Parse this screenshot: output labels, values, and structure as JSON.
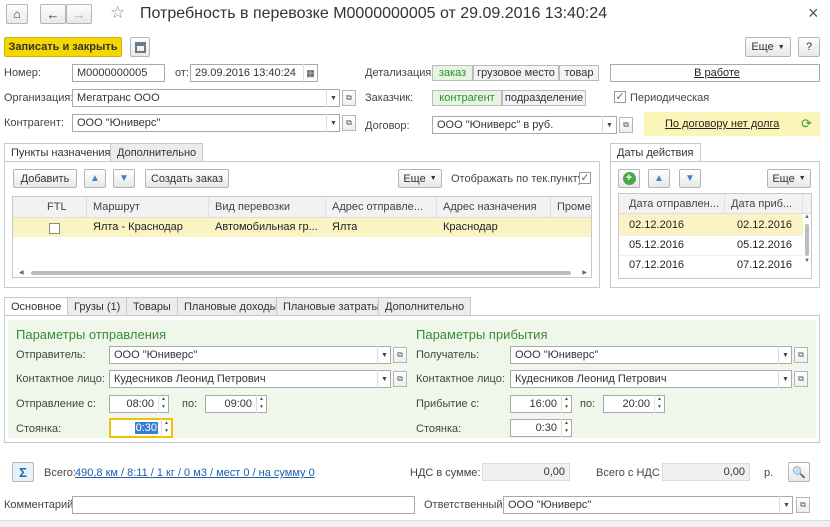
{
  "window": {
    "title": "Потребность в перевозке M0000000005 от 29.09.2016 13:40:24"
  },
  "toolbar": {
    "save_close": "Записать и закрыть",
    "more": "Еще",
    "help": "?"
  },
  "header": {
    "number_label": "Номер:",
    "number_value": "M0000000005",
    "from_label": "от:",
    "date_value": "29.09.2016 13:40:24",
    "detail_label": "Детализация:",
    "detail_options": [
      "заказ",
      "грузовое место",
      "товар"
    ],
    "status": "В работе",
    "org_label": "Организация:",
    "org_value": "Мегатранс ООО",
    "customer_label": "Заказчик:",
    "customer_options": [
      "контрагент",
      "подразделение"
    ],
    "periodic_label": "Периодическая",
    "counterparty_label": "Контрагент:",
    "counterparty_value": "ООО \"Юниверс\"",
    "contract_label": "Договор:",
    "contract_value": "ООО \"Юниверс\" в руб.",
    "debt_text": "По договору нет долга"
  },
  "points": {
    "tabs": [
      "Пункты назначения",
      "Дополнительно"
    ],
    "add": "Добавить",
    "create_order": "Создать заказ",
    "more": "Еще",
    "show_current": "Отображать по тек.пункту:",
    "columns": [
      "FTL",
      "Маршрут",
      "Вид перевозки",
      "Адрес отправле...",
      "Адрес назначения",
      "Проме"
    ],
    "rows": [
      {
        "route": "Ялта - Краснодар",
        "kind": "Автомобильная гр...",
        "from": "Ялта",
        "to": "Краснодар"
      }
    ]
  },
  "dates": {
    "tab": "Даты действия",
    "more": "Еще",
    "columns": [
      "Дата отправлен...",
      "Дата приб..."
    ],
    "rows": [
      [
        "02.12.2016",
        "02.12.2016"
      ],
      [
        "05.12.2016",
        "05.12.2016"
      ],
      [
        "07.12.2016",
        "07.12.2016"
      ]
    ]
  },
  "bottom_tabs": [
    "Основное",
    "Грузы (1)",
    "Товары",
    "Плановые доходы",
    "Плановые затраты",
    "Дополнительно"
  ],
  "departure": {
    "title": "Параметры отправления",
    "sender_label": "Отправитель:",
    "sender_value": "ООО \"Юниверс\"",
    "contact_label": "Контактное лицо:",
    "contact_value": "Кудесников Леонид Петрович",
    "from_label": "Отправление с:",
    "from_value": "08:00",
    "to_label": "по:",
    "to_value": "09:00",
    "stay_label": "Стоянка:",
    "stay_value": "0:30"
  },
  "arrival": {
    "title": "Параметры прибытия",
    "receiver_label": "Получатель:",
    "receiver_value": "ООО \"Юниверс\"",
    "contact_label": "Контактное лицо:",
    "contact_value": "Кудесников Леонид Петрович",
    "from_label": "Прибытие с:",
    "from_value": "16:00",
    "to_label": "по:",
    "to_value": "20:00",
    "stay_label": "Стоянка:",
    "stay_value": "0:30"
  },
  "summary": {
    "total_label": "Всего:",
    "total_value": "490,8 км / 8:11 / 1 кг / 0 м3 / мест 0 / на сумму 0",
    "vat_label": "НДС в сумме:",
    "vat_value": "0,00",
    "total_vat_label": "Всего с НДС",
    "total_vat_value": "0,00",
    "currency": "р."
  },
  "footer": {
    "comment_label": "Комментарий:",
    "responsible_label": "Ответственный:",
    "responsible_value": "ООО \"Юниверс\""
  }
}
